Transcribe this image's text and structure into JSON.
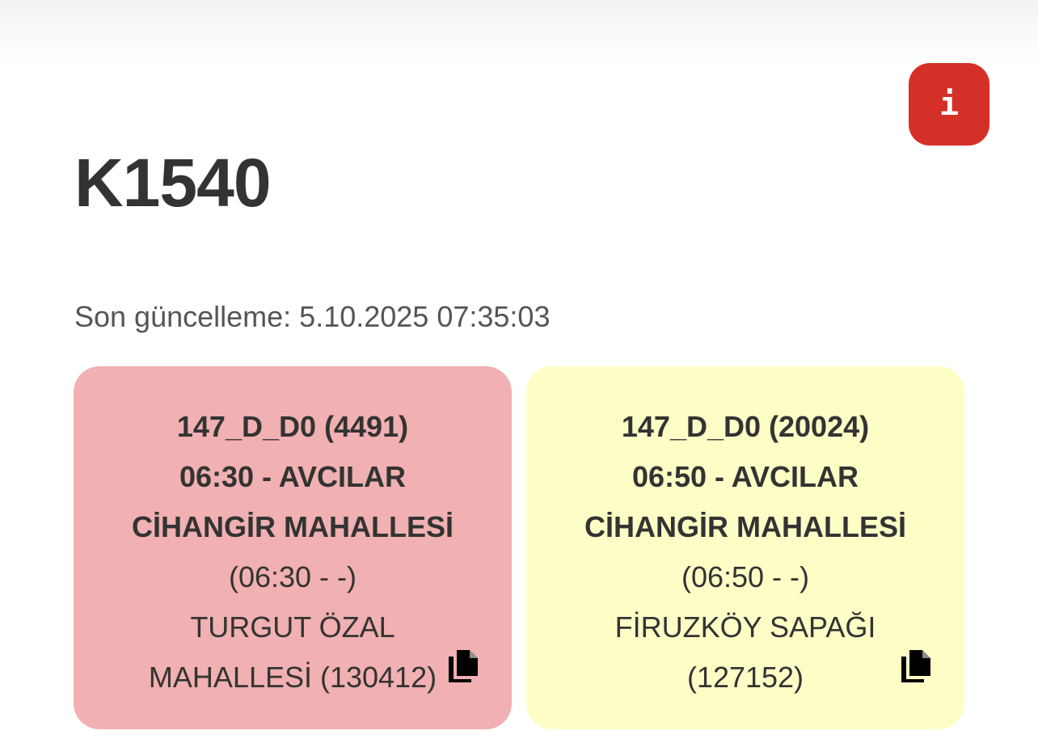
{
  "header": {
    "route_code": "K1540",
    "info_label": "i",
    "last_update": "Son güncelleme: 5.10.2025 07:35:03",
    "info_button_color": "#d53028"
  },
  "cards": [
    {
      "trip": "147_D_D0 (4491)",
      "departure": "06:30 - AVCILAR",
      "origin": "CİHANGİR MAHALLESİ",
      "time_range": "(06:30 - -)",
      "stop_line1": "TURGUT ÖZAL",
      "stop_line2": "MAHALLESİ (130412)",
      "background": "#f1b0b1",
      "icon": "copy-icon"
    },
    {
      "trip": "147_D_D0 (20024)",
      "departure": "06:50 - AVCILAR",
      "origin": "CİHANGİR MAHALLESİ",
      "time_range": "(06:50 - -)",
      "stop_line1": "FİRUZKÖY SAPAĞI",
      "stop_line2": "(127152)",
      "background": "#fdfec6",
      "icon": "copy-icon"
    }
  ]
}
